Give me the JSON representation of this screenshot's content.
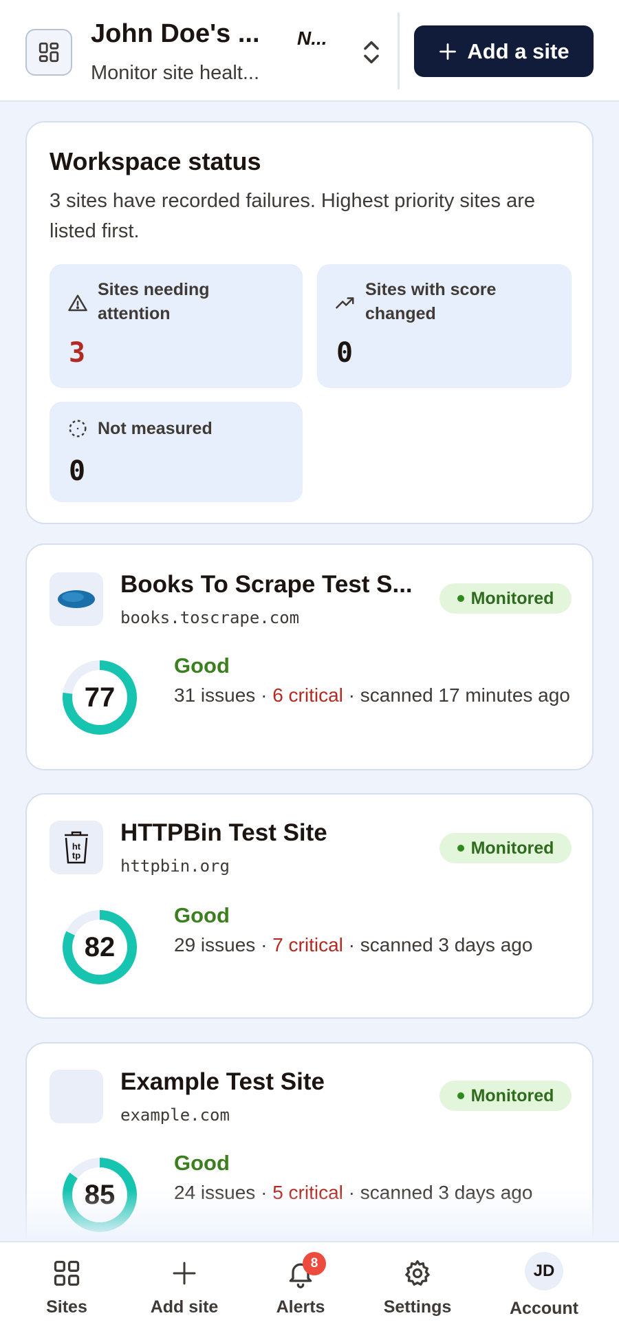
{
  "header": {
    "workspace_title": "John Doe's ...",
    "workspace_title_tail": "N...",
    "workspace_subtitle": "Monitor site healt...",
    "add_site_label": "Add a site"
  },
  "status": {
    "title": "Workspace status",
    "description": "3 sites have recorded failures. Highest priority sites are listed first.",
    "stats": [
      {
        "label": "Sites needing attention",
        "value": "3",
        "icon": "warning-icon"
      },
      {
        "label": "Sites with score changed",
        "value": "0",
        "icon": "trend-up-icon"
      },
      {
        "label": "Not measured",
        "value": "0",
        "icon": "dashed-circle-icon"
      }
    ]
  },
  "sites": [
    {
      "name": "Books To Scrape Test S...",
      "domain": "books.toscrape.com",
      "status": "Monitored",
      "score": 77,
      "grade": "Good",
      "issues": "31 issues",
      "sep1": " · ",
      "critical": "6 critical",
      "sep2": " · ",
      "scanned": "scanned 17 minutes ago"
    },
    {
      "name": "HTTPBin Test Site",
      "domain": "httpbin.org",
      "status": "Monitored",
      "score": 82,
      "grade": "Good",
      "issues": "29 issues",
      "sep1": " · ",
      "critical": "7 critical",
      "sep2": " · ",
      "scanned": "scanned 3 days ago"
    },
    {
      "name": "Example Test Site",
      "domain": "example.com",
      "status": "Monitored",
      "score": 85,
      "grade": "Good",
      "issues": "24 issues",
      "sep1": " · ",
      "critical": "5 critical",
      "sep2": " · ",
      "scanned": "scanned 3 days ago"
    }
  ],
  "nav": {
    "items": [
      {
        "label": "Sites",
        "icon": "grid-icon"
      },
      {
        "label": "Add site",
        "icon": "plus-icon"
      },
      {
        "label": "Alerts",
        "icon": "bell-icon",
        "badge": "8"
      },
      {
        "label": "Settings",
        "icon": "gear-icon"
      },
      {
        "label": "Account",
        "icon": "avatar",
        "initials": "JD"
      }
    ]
  },
  "colors": {
    "accent": "#111c3a",
    "ring": "#17c4b0",
    "ring_track": "#e9eef8",
    "critical": "#b22a22",
    "good": "#3c7f1f",
    "badge_bg": "#e3f6dc"
  }
}
